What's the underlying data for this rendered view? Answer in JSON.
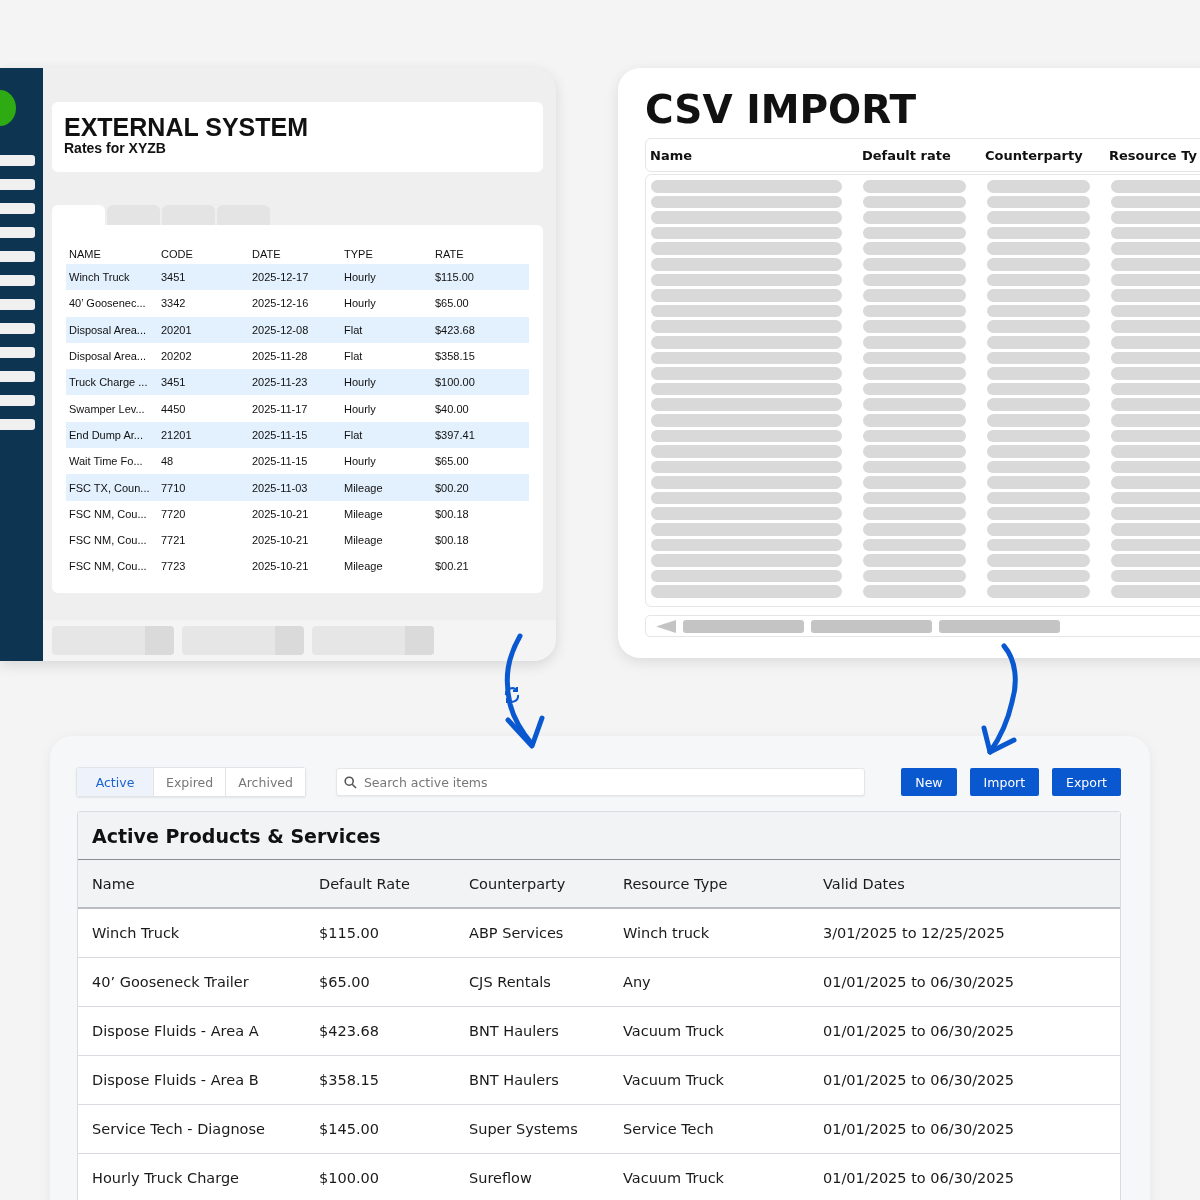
{
  "external_system": {
    "title": "EXTERNAL SYSTEM",
    "subtitle": "Rates for XYZB",
    "tabs": [
      {
        "selected": true
      },
      {
        "selected": false
      },
      {
        "selected": false
      },
      {
        "selected": false
      }
    ],
    "table": {
      "columns": [
        "NAME",
        "CODE",
        "DATE",
        "TYPE",
        "RATE"
      ],
      "rows": [
        {
          "cells": [
            "Winch Truck",
            "3451",
            "2025-12-17",
            "Hourly",
            "$115.00"
          ],
          "highlighted": true
        },
        {
          "cells": [
            "40’ Goosenec...",
            "3342",
            "2025-12-16",
            "Hourly",
            "$65.00"
          ],
          "highlighted": false
        },
        {
          "cells": [
            "Disposal Area...",
            "20201",
            "2025-12-08",
            "Flat",
            "$423.68"
          ],
          "highlighted": true
        },
        {
          "cells": [
            "Disposal Area...",
            "20202",
            "2025-11-28",
            "Flat",
            "$358.15"
          ],
          "highlighted": false
        },
        {
          "cells": [
            "Truck Charge ...",
            "3451",
            "2025-11-23",
            "Hourly",
            "$100.00"
          ],
          "highlighted": true
        },
        {
          "cells": [
            "Swamper Lev...",
            "4450",
            "2025-11-17",
            "Hourly",
            "$40.00"
          ],
          "highlighted": false
        },
        {
          "cells": [
            "End Dump Ar...",
            "21201",
            "2025-11-15",
            "Flat",
            "$397.41"
          ],
          "highlighted": true
        },
        {
          "cells": [
            "Wait Time Fo...",
            "48",
            "2025-11-15",
            "Hourly",
            "$65.00"
          ],
          "highlighted": false
        },
        {
          "cells": [
            "FSC TX, Coun...",
            "7710",
            "2025-11-03",
            "Mileage",
            "$00.20"
          ],
          "highlighted": true
        },
        {
          "cells": [
            "FSC NM, Cou...",
            "7720",
            "2025-10-21",
            "Mileage",
            "$00.18"
          ],
          "highlighted": false
        },
        {
          "cells": [
            "FSC NM, Cou...",
            "7721",
            "2025-10-21",
            "Mileage",
            "$00.18"
          ],
          "highlighted": false
        },
        {
          "cells": [
            "FSC NM, Cou...",
            "7723",
            "2025-10-21",
            "Mileage",
            "$00.21"
          ],
          "highlighted": false
        }
      ]
    }
  },
  "csv_import": {
    "title": "CSV IMPORT",
    "columns": [
      "Name",
      "Default rate",
      "Counterparty",
      "Resource Ty"
    ]
  },
  "products": {
    "tabs": [
      {
        "label": "Active",
        "selected": true
      },
      {
        "label": "Expired",
        "selected": false
      },
      {
        "label": "Archived",
        "selected": false
      }
    ],
    "search": {
      "placeholder": "Search active items"
    },
    "buttons": [
      "New",
      "Import",
      "Export"
    ],
    "title": "Active Products & Services",
    "table": {
      "columns": [
        "Name",
        "Default Rate",
        "Counterparty",
        "Resource Type",
        "Valid Dates"
      ],
      "rows": [
        [
          "Winch Truck",
          "$115.00",
          "ABP Services",
          "Winch truck",
          "3/01/2025 to 12/25/2025"
        ],
        [
          "40’ Gooseneck Trailer",
          "$65.00",
          "CJS Rentals",
          "Any",
          "01/01/2025 to 06/30/2025"
        ],
        [
          "Dispose Fluids - Area A",
          "$423.68",
          "BNT Haulers",
          "Vacuum Truck",
          "01/01/2025 to 06/30/2025"
        ],
        [
          "Dispose Fluids - Area B",
          "$358.15",
          "BNT Haulers",
          "Vacuum Truck",
          "01/01/2025 to 06/30/2025"
        ],
        [
          "Service Tech - Diagnose",
          "$145.00",
          "Super Systems",
          "Service Tech",
          "01/01/2025 to 06/30/2025"
        ],
        [
          "Hourly Truck Charge",
          "$100.00",
          "Sureflow",
          "Vacuum Truck",
          "01/01/2025 to 06/30/2025"
        ]
      ]
    }
  }
}
